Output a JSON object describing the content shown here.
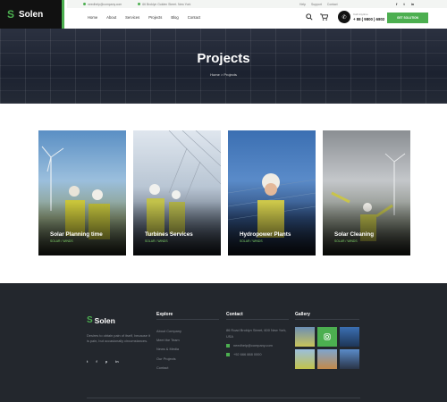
{
  "header": {
    "logo": "Solen",
    "topbar_email": "needhelp@company.com",
    "topbar_address": "66 Broklyn Golden Street. New York",
    "toplinks": [
      "Help",
      "Support",
      "Contact"
    ],
    "socials": [
      "f",
      "t",
      "in"
    ],
    "nav": [
      "Home",
      "About",
      "Services",
      "Projects",
      "Blog",
      "Contact"
    ],
    "phone_label": "Call Anytime",
    "phone_number": "+ 88 ( 9800 ) 6802",
    "cta": "GET SOLUTION"
  },
  "hero": {
    "title": "Projects",
    "breadcrumb_home": "Home",
    "breadcrumb_sep": ">",
    "breadcrumb_current": "Projects"
  },
  "projects": [
    {
      "title": "Solar Planning time",
      "category": "SOLAR / WINDS"
    },
    {
      "title": "Turbines Services",
      "category": "SOLAR / WINDS"
    },
    {
      "title": "Hydropower Plants",
      "category": "SOLAR / WINDS"
    },
    {
      "title": "Solar Cleaning",
      "category": "SOLAR / WINDS"
    }
  ],
  "footer": {
    "logo": "Solen",
    "description": "Desires to obtain pain of itself, because it is pain, but occasionally circumstances.",
    "socials": [
      "t",
      "f",
      "p",
      "in"
    ],
    "explore_title": "Explore",
    "explore_links": [
      "About Company",
      "Meet the Team",
      "News & Media",
      "Our Projects",
      "Contact"
    ],
    "contact_title": "Contact",
    "contact_address": "86 Road Broklyn Street, 600 New York, USA",
    "contact_email": "needhelp@company.com",
    "contact_phone": "+92 666 888 0000",
    "gallery_title": "Gallery"
  },
  "colors": {
    "accent": "#4caf50",
    "dark": "#111111",
    "footer": "#23272d"
  }
}
